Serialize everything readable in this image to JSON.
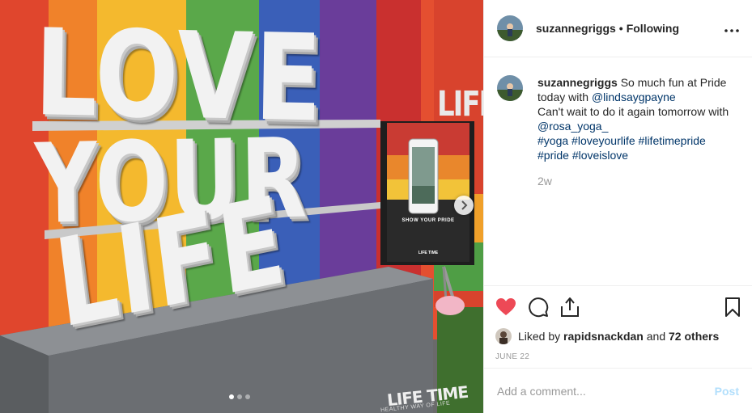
{
  "photo": {
    "words": {
      "line1": "LOVE",
      "line2": "YOUR",
      "line3": "LIFE"
    },
    "sign_text": "LIFE",
    "poster_title": "SHOW YOUR PRIDE",
    "poster_brand": "LIFE TIME",
    "box_brand": "LIFE TIME",
    "box_tagline": "HEALTHY WAY OF LIFE",
    "carousel": {
      "total": 3,
      "active": 1
    },
    "next_icon": "chevron-right-icon"
  },
  "header": {
    "username": "suzannegriggs",
    "separator": "•",
    "follow_status": "Following",
    "more_icon": "more-options-icon"
  },
  "caption": {
    "username": "suzannegriggs",
    "text1": "So much fun at Pride today with ",
    "mention1": "@lindsaygpayne",
    "text2": "Can't wait to do it again tomorrow with ",
    "mention2": "@rosa_yoga_",
    "hashtags": [
      "#yoga",
      "#loveyourlife",
      "#lifetimepride",
      "#pride",
      "#loveislove"
    ],
    "time_ago": "2w"
  },
  "actions": {
    "like_icon": "heart-icon",
    "comment_icon": "comment-icon",
    "share_icon": "share-icon",
    "save_icon": "bookmark-icon",
    "liked": true,
    "like_color": "#ed4956"
  },
  "likes": {
    "prefix": "Liked by ",
    "user": "rapidsnackdan",
    "middle": " and ",
    "others": "72 others"
  },
  "date": "JUNE 22",
  "comment_box": {
    "placeholder": "Add a comment...",
    "post_label": "Post"
  }
}
